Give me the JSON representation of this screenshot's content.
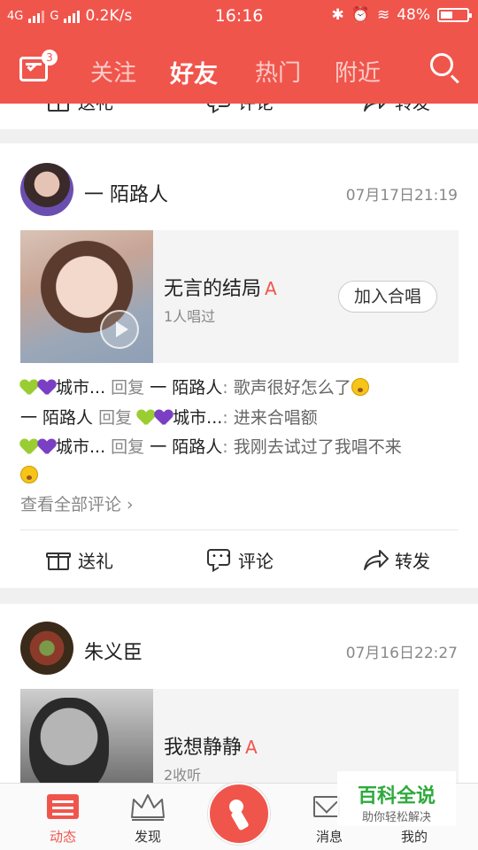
{
  "status_bar": {
    "network1": "4G",
    "network2": "G",
    "speed": "0.2K/s",
    "time": "16:16",
    "battery": "48%",
    "battery_level": 0.48
  },
  "header": {
    "badge_count": "3",
    "tabs": [
      {
        "label": "关注",
        "active": false
      },
      {
        "label": "好友",
        "active": true
      },
      {
        "label": "热门",
        "active": false
      },
      {
        "label": "附近",
        "active": false
      }
    ]
  },
  "actions": {
    "gift": "送礼",
    "comment": "评论",
    "share": "转发"
  },
  "posts": [
    {
      "user": "一 陌路人",
      "datetime": "07月17日21:19",
      "song_title": "无言的结局",
      "grade": "A",
      "song_sub": "1人唱过",
      "join_label": "加入合唱",
      "comments": [
        {
          "from": "城市...",
          "reply": "回复",
          "to": "一 陌路人",
          "colon": ":",
          "text": "歌声很好怎么了"
        },
        {
          "from": "一 陌路人",
          "reply": "回复",
          "to": "城市...",
          "colon": ":",
          "text": "进来合唱额"
        },
        {
          "from": "城市...",
          "reply": "回复",
          "to": "一 陌路人",
          "colon": ":",
          "text": "我刚去试过了我唱不来"
        }
      ],
      "see_all": "查看全部评论 ›"
    },
    {
      "user": "朱义臣",
      "datetime": "07月16日22:27",
      "song_title": "我想静静",
      "grade": "A",
      "song_sub": "2收听"
    }
  ],
  "bottom_nav": {
    "items": [
      {
        "label": "动态",
        "active": true
      },
      {
        "label": "发现",
        "active": false
      },
      {
        "label": "消息",
        "active": false
      },
      {
        "label": "我的",
        "active": false
      }
    ]
  },
  "watermark": {
    "title": "百科全说",
    "subtitle": "助你轻松解决"
  },
  "colors": {
    "accent": "#f0554c",
    "grade": "#f0554c",
    "watermark": "#2eaa3c"
  }
}
